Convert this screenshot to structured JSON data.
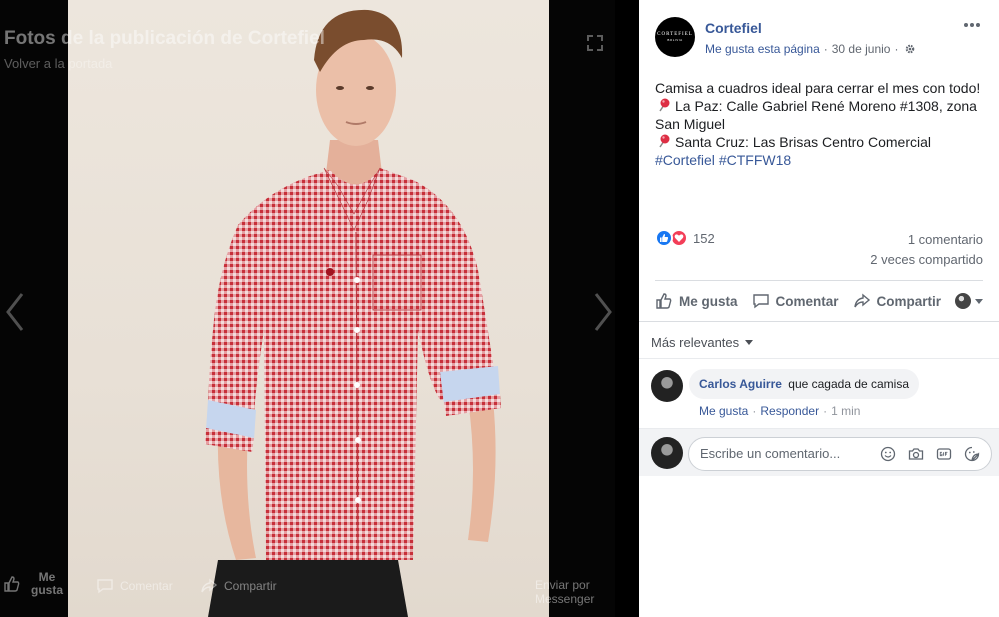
{
  "viewer": {
    "title": "Fotos de la publicación de Cortefiel",
    "subtitle": "Volver a la portada",
    "bottom_bar": {
      "like_label": "Me gusta",
      "comment_label": "Comentar",
      "share_label": "Compartir",
      "send_label": "Enviar por Messenger"
    }
  },
  "post": {
    "page_name": "Cortefiel",
    "logo_text": "CORTEFIEL",
    "logo_subtext": "BOLIVIA",
    "like_page_label": "Me gusta esta página",
    "date": "30 de junio",
    "text_line1": "Camisa a cuadros ideal para cerrar el mes con todo!",
    "text_line2": "La Paz: Calle Gabriel René Moreno #1308, zona",
    "text_line3": "San Miguel",
    "text_line4": "Santa Cruz: Las Brisas Centro Comercial",
    "hashtag1": "#Cortefiel",
    "hashtag2": "#CTFFW18",
    "reaction_count": "152",
    "comments_count": "1 comentario",
    "shares_count": "2 veces compartido"
  },
  "actions": {
    "like": "Me gusta",
    "comment": "Comentar",
    "share": "Compartir"
  },
  "comments": {
    "sort_label": "Más relevantes",
    "items": [
      {
        "author": "Carlos Aguirre",
        "text": "que cagada de camisa",
        "like_label": "Me gusta",
        "reply_label": "Responder",
        "time": "1 min"
      }
    ],
    "composer_placeholder": "Escribe un comentario..."
  },
  "colors": {
    "link": "#385898",
    "like_blue": "#1877f2",
    "love_red": "#f33e58",
    "shirt_red": "#d6313c"
  },
  "icons": [
    "gear-icon",
    "more-icon",
    "pin-icon",
    "like-icon",
    "comment-icon",
    "share-icon",
    "emoji-icon",
    "camera-icon",
    "gif-icon",
    "sticker-icon",
    "expand-icon",
    "chevron-left-icon",
    "chevron-right-icon"
  ]
}
